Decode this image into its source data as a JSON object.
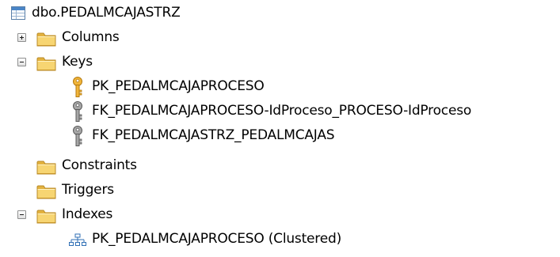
{
  "tree": {
    "root": {
      "label": "dbo.PEDALMCAJASTRZ",
      "icon": "table-icon"
    },
    "columns": {
      "label": "Columns",
      "expander": "+"
    },
    "keys": {
      "label": "Keys",
      "expander": "-",
      "items": [
        {
          "label": "PK_PEDALMCAJAPROCESO",
          "icon": "primary-key-icon"
        },
        {
          "label": "FK_PEDALMCAJAPROCESO-IdProceso_PROCESO-IdProceso",
          "icon": "foreign-key-icon"
        },
        {
          "label": "FK_PEDALMCAJASTRZ_PEDALMCAJAS",
          "icon": "foreign-key-icon"
        }
      ]
    },
    "constraints": {
      "label": "Constraints"
    },
    "triggers": {
      "label": "Triggers"
    },
    "indexes": {
      "label": "Indexes",
      "expander": "-",
      "items": [
        {
          "label": "PK_PEDALMCAJAPROCESO (Clustered)",
          "icon": "clustered-index-icon"
        }
      ]
    }
  },
  "colors": {
    "folder": "#f3cd5b",
    "folder_dark": "#c9962b",
    "primary_key": "#e8a828",
    "foreign_key": "#8c8c8c",
    "table_header": "#3e7fc1",
    "index": "#2f6fb5"
  }
}
